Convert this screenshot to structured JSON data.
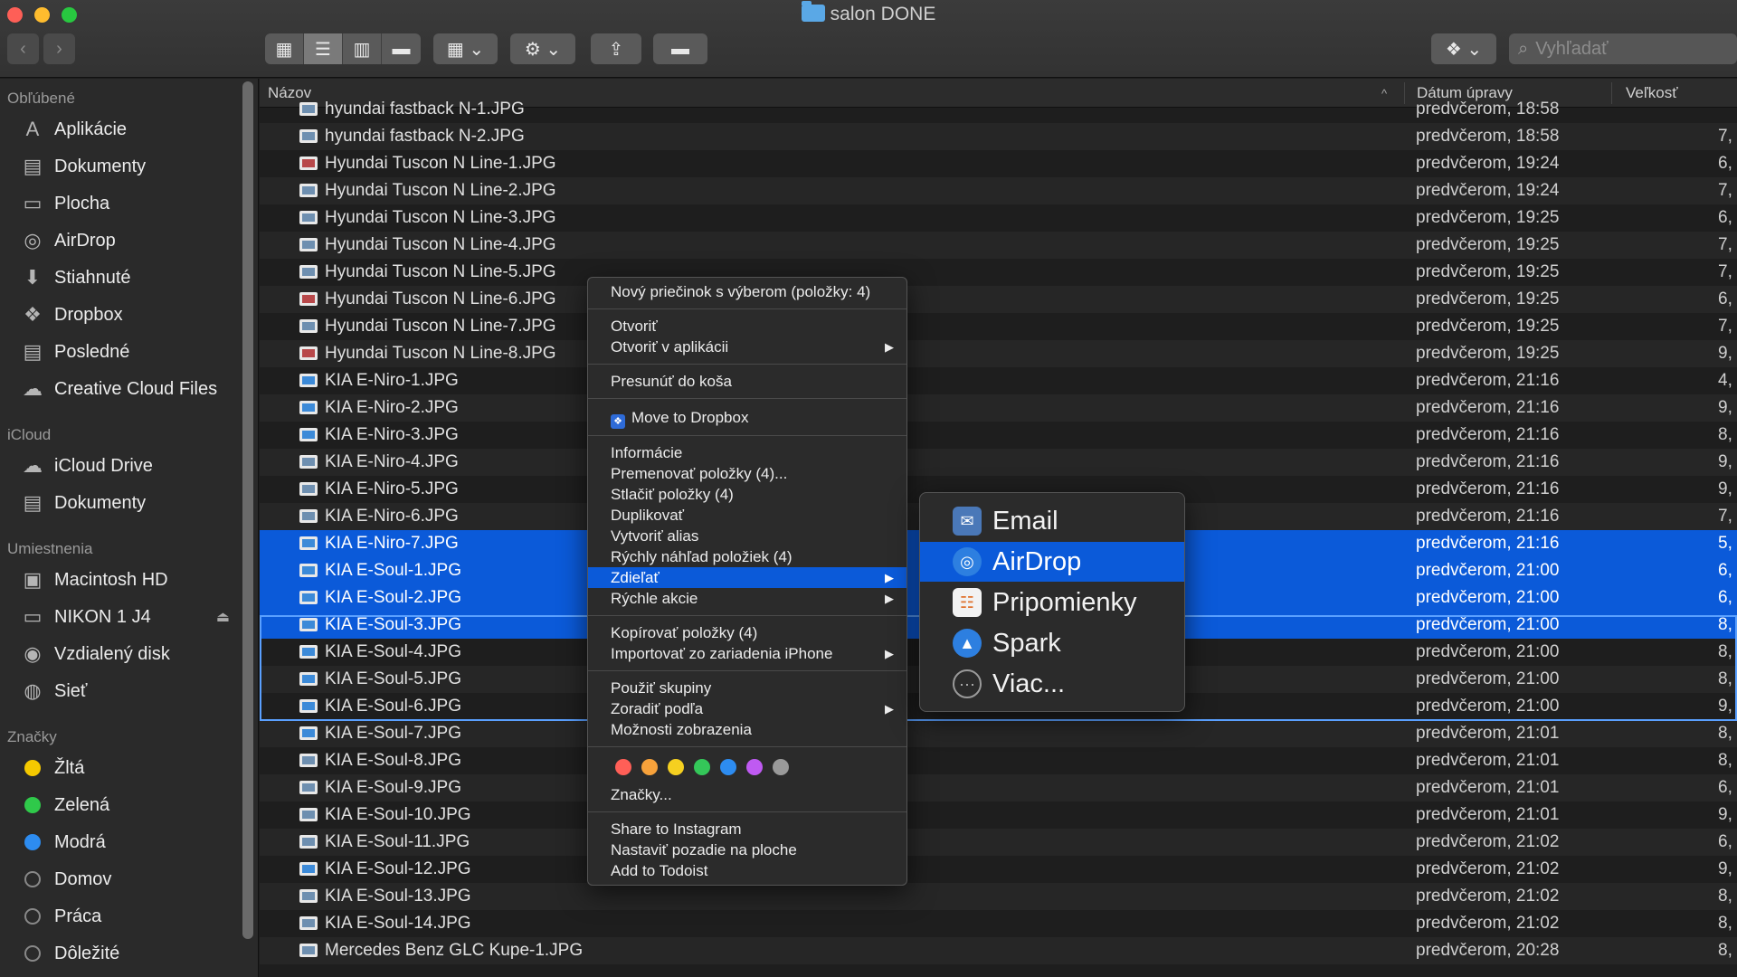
{
  "window": {
    "title": "salon DONE"
  },
  "toolbar": {
    "back_icon": "‹",
    "forward_icon": "›",
    "search_placeholder": "Vyhľadať"
  },
  "sidebar": {
    "favorites_title": "Obľúbené",
    "favorites": [
      {
        "label": "Aplikácie",
        "icon": "apps-icon"
      },
      {
        "label": "Dokumenty",
        "icon": "documents-icon"
      },
      {
        "label": "Plocha",
        "icon": "desktop-icon"
      },
      {
        "label": "AirDrop",
        "icon": "airdrop-icon"
      },
      {
        "label": "Stiahnuté",
        "icon": "downloads-icon"
      },
      {
        "label": "Dropbox",
        "icon": "dropbox-icon"
      },
      {
        "label": "Posledné",
        "icon": "recents-icon"
      },
      {
        "label": "Creative Cloud Files",
        "icon": "creative-cloud-icon"
      }
    ],
    "icloud_title": "iCloud",
    "icloud": [
      {
        "label": "iCloud Drive",
        "icon": "cloud-icon"
      },
      {
        "label": "Dokumenty",
        "icon": "documents-icon"
      }
    ],
    "locations_title": "Umiestnenia",
    "locations": [
      {
        "label": "Macintosh HD",
        "icon": "disk-icon"
      },
      {
        "label": "NIKON 1 J4",
        "icon": "disk-icon"
      },
      {
        "label": "Vzdialený disk",
        "icon": "remote-disk-icon"
      },
      {
        "label": "Sieť",
        "icon": "network-icon"
      }
    ],
    "tags_title": "Značky",
    "tags": [
      {
        "label": "Žltá",
        "color": "#f5c900"
      },
      {
        "label": "Zelená",
        "color": "#2fc94a"
      },
      {
        "label": "Modrá",
        "color": "#2d8cf0"
      },
      {
        "label": "Domov",
        "color": ""
      },
      {
        "label": "Práca",
        "color": ""
      },
      {
        "label": "Dôležité",
        "color": ""
      }
    ]
  },
  "columns": {
    "name": "Názov",
    "date": "Dátum úpravy",
    "size": "Veľkosť"
  },
  "files": [
    {
      "name": "hyundai fastback N-1.JPG",
      "date": "predvčerom, 18:58",
      "size": ""
    },
    {
      "name": "hyundai fastback N-2.JPG",
      "date": "predvčerom, 18:58",
      "size": "7,"
    },
    {
      "name": "Hyundai Tuscon N Line-1.JPG",
      "date": "predvčerom, 19:24",
      "size": "6,"
    },
    {
      "name": "Hyundai Tuscon N Line-2.JPG",
      "date": "predvčerom, 19:24",
      "size": "7,"
    },
    {
      "name": "Hyundai Tuscon N Line-3.JPG",
      "date": "predvčerom, 19:25",
      "size": "6,"
    },
    {
      "name": "Hyundai Tuscon N Line-4.JPG",
      "date": "predvčerom, 19:25",
      "size": "7,"
    },
    {
      "name": "Hyundai Tuscon N Line-5.JPG",
      "date": "predvčerom, 19:25",
      "size": "7,"
    },
    {
      "name": "Hyundai Tuscon N Line-6.JPG",
      "date": "predvčerom, 19:25",
      "size": "6,"
    },
    {
      "name": "Hyundai Tuscon N Line-7.JPG",
      "date": "predvčerom, 19:25",
      "size": "7,"
    },
    {
      "name": "Hyundai Tuscon N Line-8.JPG",
      "date": "predvčerom, 19:25",
      "size": "9,"
    },
    {
      "name": "KIA E-Niro-1.JPG",
      "date": "predvčerom, 21:16",
      "size": "4,"
    },
    {
      "name": "KIA E-Niro-2.JPG",
      "date": "predvčerom, 21:16",
      "size": "9,"
    },
    {
      "name": "KIA E-Niro-3.JPG",
      "date": "predvčerom, 21:16",
      "size": "8,"
    },
    {
      "name": "KIA E-Niro-4.JPG",
      "date": "predvčerom, 21:16",
      "size": "9,"
    },
    {
      "name": "KIA E-Niro-5.JPG",
      "date": "predvčerom, 21:16",
      "size": "9,"
    },
    {
      "name": "KIA E-Niro-6.JPG",
      "date": "predvčerom, 21:16",
      "size": "7,"
    },
    {
      "name": "KIA E-Niro-7.JPG",
      "date": "predvčerom, 21:16",
      "size": "5,"
    },
    {
      "name": "KIA E-Soul-1.JPG",
      "date": "predvčerom, 21:00",
      "size": "6,"
    },
    {
      "name": "KIA E-Soul-2.JPG",
      "date": "predvčerom, 21:00",
      "size": "6,"
    },
    {
      "name": "KIA E-Soul-3.JPG",
      "date": "predvčerom, 21:00",
      "size": "8,"
    },
    {
      "name": "KIA E-Soul-4.JPG",
      "date": "predvčerom, 21:00",
      "size": "8,"
    },
    {
      "name": "KIA E-Soul-5.JPG",
      "date": "predvčerom, 21:00",
      "size": "8,"
    },
    {
      "name": "KIA E-Soul-6.JPG",
      "date": "predvčerom, 21:00",
      "size": "9,"
    },
    {
      "name": "KIA E-Soul-7.JPG",
      "date": "predvčerom, 21:01",
      "size": "8,"
    },
    {
      "name": "KIA E-Soul-8.JPG",
      "date": "predvčerom, 21:01",
      "size": "8,"
    },
    {
      "name": "KIA E-Soul-9.JPG",
      "date": "predvčerom, 21:01",
      "size": "6,"
    },
    {
      "name": "KIA E-Soul-10.JPG",
      "date": "predvčerom, 21:01",
      "size": "9,"
    },
    {
      "name": "KIA E-Soul-11.JPG",
      "date": "predvčerom, 21:02",
      "size": "6,"
    },
    {
      "name": "KIA E-Soul-12.JPG",
      "date": "predvčerom, 21:02",
      "size": "9,"
    },
    {
      "name": "KIA E-Soul-13.JPG",
      "date": "predvčerom, 21:02",
      "size": "8,"
    },
    {
      "name": "KIA E-Soul-14.JPG",
      "date": "predvčerom, 21:02",
      "size": "8,"
    },
    {
      "name": "Mercedes Benz GLC Kupe-1.JPG",
      "date": "predvčerom, 20:28",
      "size": "8,"
    }
  ],
  "context_menu": {
    "new_folder": "Nový priečinok s výberom (položky: 4)",
    "open": "Otvoriť",
    "open_with": "Otvoriť v aplikácii",
    "move_to_trash": "Presunúť do koša",
    "move_to_dropbox": "Move to Dropbox",
    "info": "Informácie",
    "rename": "Premenovať položky (4)...",
    "compress": "Stlačiť položky (4)",
    "duplicate": "Duplikovať",
    "make_alias": "Vytvoriť alias",
    "quick_look": "Rýchly náhľad položiek (4)",
    "share": "Zdieľať",
    "quick_actions": "Rýchle akcie",
    "copy": "Kopírovať položky (4)",
    "import_iphone": "Importovať zo zariadenia iPhone",
    "use_groups": "Použiť skupiny",
    "sort_by": "Zoradiť podľa",
    "view_options": "Možnosti zobrazenia",
    "tag_colors": [
      "#ff5f57",
      "#f7a23b",
      "#f5d020",
      "#34c759",
      "#2d8cf0",
      "#bf5af2",
      "#9a9a9a"
    ],
    "tags": "Značky...",
    "share_instagram": "Share to Instagram",
    "set_desktop": "Nastaviť pozadie na ploche",
    "add_todoist": "Add to Todoist"
  },
  "share_menu": [
    {
      "label": "Email",
      "icon": "mail-icon"
    },
    {
      "label": "AirDrop",
      "icon": "airdrop-icon"
    },
    {
      "label": "Pripomienky",
      "icon": "reminders-icon"
    },
    {
      "label": "Spark",
      "icon": "spark-icon"
    },
    {
      "label": "Viac...",
      "icon": "more-icon"
    }
  ]
}
